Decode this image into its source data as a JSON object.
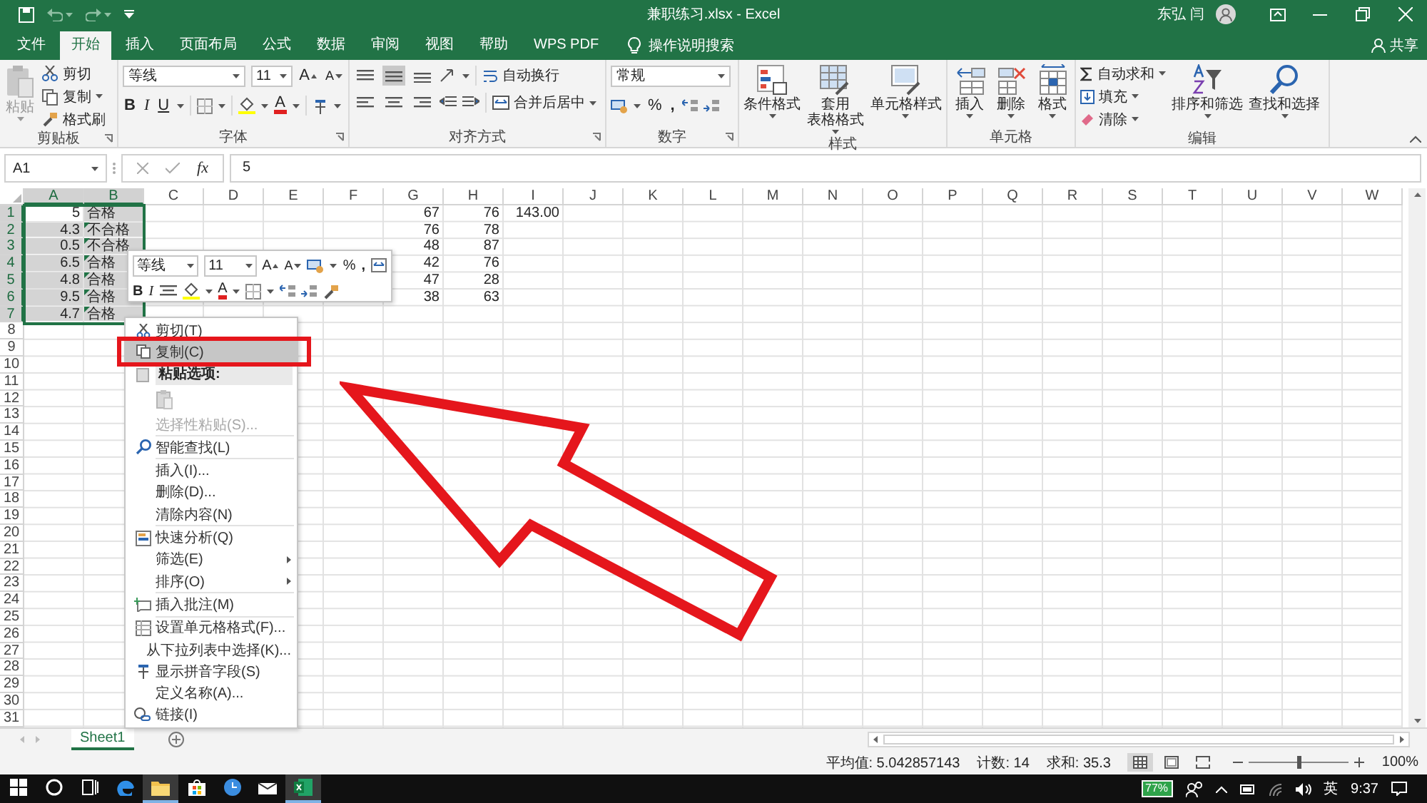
{
  "title_bar": {
    "title": "兼职练习.xlsx  -  Excel",
    "user": "东弘 闫"
  },
  "tabs": [
    {
      "label": "文件",
      "selected": false
    },
    {
      "label": "开始",
      "selected": true
    },
    {
      "label": "插入",
      "selected": false
    },
    {
      "label": "页面布局",
      "selected": false
    },
    {
      "label": "公式",
      "selected": false
    },
    {
      "label": "数据",
      "selected": false
    },
    {
      "label": "审阅",
      "selected": false
    },
    {
      "label": "视图",
      "selected": false
    },
    {
      "label": "帮助",
      "selected": false
    },
    {
      "label": "WPS PDF",
      "selected": false
    }
  ],
  "tell_me": {
    "label": "操作说明搜索"
  },
  "share": {
    "label": "共享"
  },
  "ribbon": {
    "clipboard": {
      "label": "剪贴板",
      "paste": {
        "label": "粘贴",
        "disabled": true
      },
      "cut": "剪切",
      "copy": "复制",
      "format_painter": "格式刷"
    },
    "font": {
      "label": "字体",
      "font_name": "等线",
      "font_size": "11",
      "grow": "A",
      "shrink": "A",
      "bold": "B",
      "italic": "I",
      "underline": "U",
      "font_color": "A"
    },
    "alignment": {
      "label": "对齐方式",
      "vertical_align": [
        {
          "selected": false
        },
        {
          "selected": true
        },
        {
          "selected": false
        }
      ],
      "wrap_text": "自动换行",
      "merge_center": "合并后居中"
    },
    "number": {
      "label": "数字",
      "format": "常规",
      "percent": "%",
      "comma": ","
    },
    "styles": {
      "label": "样式",
      "buttons": [
        {
          "label": "条件格式"
        },
        {
          "label": "套用",
          "label_2": "表格格式"
        },
        {
          "label": "单元格样式"
        }
      ]
    },
    "cells": {
      "label": "单元格",
      "buttons": [
        "插入",
        "删除",
        "格式"
      ]
    },
    "editing": {
      "label": "编辑",
      "autosum": "自动求和",
      "fill": "填充",
      "clear": "清除",
      "sort_filter": "排序和筛选",
      "find_select": "查找和选择"
    }
  },
  "formula_bar": {
    "name_box": "A1",
    "fx": "fx",
    "value": "5"
  },
  "sheet": {
    "columns": [
      {
        "label": "A",
        "selected": true
      },
      {
        "label": "B",
        "selected": true
      },
      {
        "label": "C",
        "selected": false
      },
      {
        "label": "D",
        "selected": false
      },
      {
        "label": "E",
        "selected": false
      },
      {
        "label": "F",
        "selected": false
      },
      {
        "label": "G",
        "selected": false
      },
      {
        "label": "H",
        "selected": false
      },
      {
        "label": "I",
        "selected": false
      },
      {
        "label": "J",
        "selected": false
      },
      {
        "label": "K",
        "selected": false
      },
      {
        "label": "L",
        "selected": false
      },
      {
        "label": "M",
        "selected": false
      },
      {
        "label": "N",
        "selected": false
      },
      {
        "label": "O",
        "selected": false
      },
      {
        "label": "P",
        "selected": false
      },
      {
        "label": "Q",
        "selected": false
      },
      {
        "label": "R",
        "selected": false
      },
      {
        "label": "S",
        "selected": false
      },
      {
        "label": "T",
        "selected": false
      },
      {
        "label": "U",
        "selected": false
      },
      {
        "label": "V",
        "selected": false
      },
      {
        "label": "W",
        "selected": false
      }
    ],
    "rows": [
      {
        "label": "1",
        "selected": true,
        "cells": [
          {
            "value": "5",
            "kind": "number",
            "selected": true,
            "active": true,
            "error_flag": false
          },
          {
            "value": "合格",
            "kind": "text",
            "selected": true,
            "error_flag": false
          },
          null,
          null,
          null,
          null,
          {
            "value": "67",
            "kind": "number",
            "selected": false,
            "error_flag": false
          },
          {
            "value": "76",
            "kind": "number",
            "selected": false,
            "error_flag": false
          },
          {
            "value": "143.00",
            "kind": "number",
            "selected": false,
            "error_flag": false
          }
        ]
      },
      {
        "label": "2",
        "selected": true,
        "cells": [
          {
            "value": "4.3",
            "kind": "number",
            "selected": true,
            "error_flag": false
          },
          {
            "value": "不合格",
            "kind": "text",
            "selected": true,
            "error_flag": true
          },
          null,
          null,
          null,
          null,
          {
            "value": "76",
            "kind": "number",
            "selected": false,
            "error_flag": false
          },
          {
            "value": "78",
            "kind": "number",
            "selected": false,
            "error_flag": false
          }
        ]
      },
      {
        "label": "3",
        "selected": true,
        "cells": [
          {
            "value": "0.5",
            "kind": "number",
            "selected": true,
            "error_flag": false
          },
          {
            "value": "不合格",
            "kind": "text",
            "selected": true,
            "error_flag": true
          },
          null,
          null,
          null,
          null,
          {
            "value": "48",
            "kind": "number",
            "selected": false,
            "error_flag": false
          },
          {
            "value": "87",
            "kind": "number",
            "selected": false,
            "error_flag": false
          }
        ]
      },
      {
        "label": "4",
        "selected": true,
        "cells": [
          {
            "value": "6.5",
            "kind": "number",
            "selected": true,
            "error_flag": false
          },
          {
            "value": "合格",
            "kind": "text",
            "selected": true,
            "error_flag": true
          },
          null,
          null,
          null,
          null,
          {
            "value": "42",
            "kind": "number",
            "selected": false,
            "error_flag": false
          },
          {
            "value": "76",
            "kind": "number",
            "selected": false,
            "error_flag": false
          }
        ]
      },
      {
        "label": "5",
        "selected": true,
        "cells": [
          {
            "value": "4.8",
            "kind": "number",
            "selected": true,
            "error_flag": false
          },
          {
            "value": "合格",
            "kind": "text",
            "selected": true,
            "error_flag": true
          },
          null,
          null,
          null,
          null,
          {
            "value": "47",
            "kind": "number",
            "selected": false,
            "error_flag": false
          },
          {
            "value": "28",
            "kind": "number",
            "selected": false,
            "error_flag": false
          }
        ]
      },
      {
        "label": "6",
        "selected": true,
        "cells": [
          {
            "value": "9.5",
            "kind": "number",
            "selected": true,
            "error_flag": false
          },
          {
            "value": "合格",
            "kind": "text",
            "selected": true,
            "error_flag": true
          },
          null,
          null,
          null,
          null,
          {
            "value": "38",
            "kind": "number",
            "selected": false,
            "error_flag": false
          },
          {
            "value": "63",
            "kind": "number",
            "selected": false,
            "error_flag": false
          }
        ]
      },
      {
        "label": "7",
        "selected": true,
        "cells": [
          {
            "value": "4.7",
            "kind": "number",
            "selected": true,
            "error_flag": false
          },
          {
            "value": "合格",
            "kind": "text",
            "selected": true,
            "error_flag": true
          }
        ]
      },
      {
        "label": "8",
        "selected": false
      },
      {
        "label": "9",
        "selected": false
      },
      {
        "label": "10",
        "selected": false
      },
      {
        "label": "11",
        "selected": false
      },
      {
        "label": "12",
        "selected": false
      },
      {
        "label": "13",
        "selected": false
      },
      {
        "label": "14",
        "selected": false
      },
      {
        "label": "15",
        "selected": false
      },
      {
        "label": "16",
        "selected": false
      },
      {
        "label": "17",
        "selected": false
      },
      {
        "label": "18",
        "selected": false
      },
      {
        "label": "19",
        "selected": false
      },
      {
        "label": "20",
        "selected": false
      },
      {
        "label": "21",
        "selected": false
      },
      {
        "label": "22",
        "selected": false
      },
      {
        "label": "23",
        "selected": false
      },
      {
        "label": "24",
        "selected": false
      },
      {
        "label": "25",
        "selected": false
      },
      {
        "label": "26",
        "selected": false
      },
      {
        "label": "27",
        "selected": false
      },
      {
        "label": "28",
        "selected": false
      },
      {
        "label": "29",
        "selected": false
      },
      {
        "label": "30",
        "selected": false
      },
      {
        "label": "31",
        "selected": false
      }
    ]
  },
  "sheet_tabs": [
    {
      "label": "Sheet1",
      "selected": true
    }
  ],
  "status_bar": {
    "average": "平均值: 5.042857143",
    "count": "计数: 14",
    "sum": "求和: 35.3",
    "views": [
      {
        "selected": true
      },
      {
        "selected": false
      },
      {
        "selected": false
      }
    ],
    "zoom": {
      "level": 0.5,
      "label": "100%"
    }
  },
  "taskbar": {
    "apps": [
      {
        "running": false
      },
      {
        "running": true
      },
      {
        "running": false
      },
      {
        "running": false
      },
      {
        "running": false
      },
      {
        "running": true
      }
    ],
    "battery": "77%",
    "input_method": "英",
    "time": "9:37"
  },
  "mini_toolbar": {
    "font_name": "等线",
    "font_size": "11",
    "grow": "A",
    "shrink": "A",
    "percent": "%",
    "comma": ",",
    "bold": "B",
    "italic": "I",
    "font_color": "A"
  },
  "context_menu": {
    "items": [
      {
        "kind": "item",
        "label": "剪切(T)",
        "selected": false,
        "disabled": false,
        "submenu": false
      },
      {
        "kind": "item",
        "label": "复制(C)",
        "selected": true,
        "disabled": false,
        "submenu": false
      },
      {
        "kind": "header",
        "label": "粘贴选项:"
      },
      {
        "kind": "paste_options"
      },
      {
        "kind": "item",
        "label": "选择性粘贴(S)...",
        "selected": false,
        "disabled": true,
        "submenu": false
      },
      {
        "kind": "separator"
      },
      {
        "kind": "item",
        "label": "智能查找(L)",
        "selected": false,
        "disabled": false,
        "submenu": false
      },
      {
        "kind": "separator"
      },
      {
        "kind": "item",
        "label": "插入(I)...",
        "selected": false,
        "disabled": false,
        "submenu": false
      },
      {
        "kind": "item",
        "label": "删除(D)...",
        "selected": false,
        "disabled": false,
        "submenu": false
      },
      {
        "kind": "item",
        "label": "清除内容(N)",
        "selected": false,
        "disabled": false,
        "submenu": false
      },
      {
        "kind": "separator"
      },
      {
        "kind": "item",
        "label": "快速分析(Q)",
        "selected": false,
        "disabled": false,
        "submenu": false
      },
      {
        "kind": "item",
        "label": "筛选(E)",
        "selected": false,
        "disabled": false,
        "submenu": true
      },
      {
        "kind": "item",
        "label": "排序(O)",
        "selected": false,
        "disabled": false,
        "submenu": true
      },
      {
        "kind": "separator"
      },
      {
        "kind": "item",
        "label": "插入批注(M)",
        "selected": false,
        "disabled": false,
        "submenu": false
      },
      {
        "kind": "separator"
      },
      {
        "kind": "item",
        "label": "设置单元格格式(F)...",
        "selected": false,
        "disabled": false,
        "submenu": false
      },
      {
        "kind": "item",
        "label": "从下拉列表中选择(K)...",
        "selected": false,
        "disabled": false,
        "submenu": false
      },
      {
        "kind": "item",
        "label": "显示拼音字段(S)",
        "selected": false,
        "disabled": false,
        "submenu": false
      },
      {
        "kind": "item",
        "label": "定义名称(A)...",
        "selected": false,
        "disabled": false,
        "submenu": false
      },
      {
        "kind": "item",
        "label": "链接(I)",
        "selected": false,
        "disabled": false,
        "submenu": false
      }
    ]
  }
}
